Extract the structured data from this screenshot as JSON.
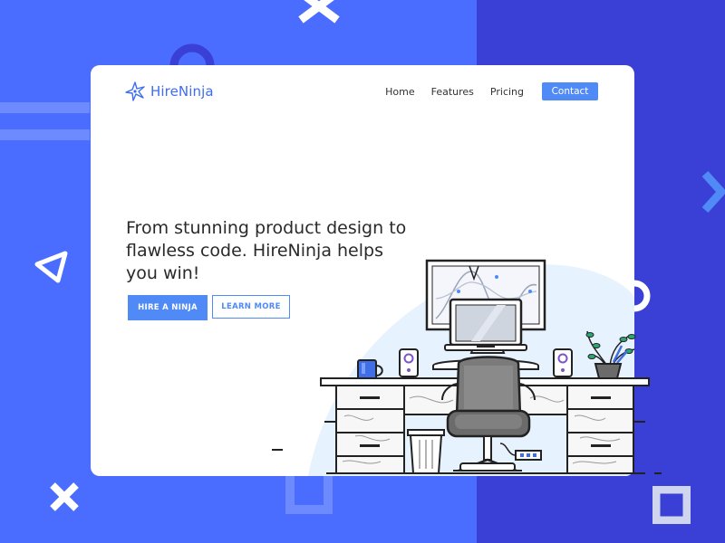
{
  "brand": {
    "name": "HireNinja",
    "logo_icon": "shuriken-icon",
    "accent": "#4f8af7",
    "logo_color": "#3d6cf2"
  },
  "nav": {
    "items": [
      {
        "label": "Home"
      },
      {
        "label": "Features"
      },
      {
        "label": "Pricing"
      }
    ],
    "contact_label": "Contact"
  },
  "hero": {
    "headline": "From stunning product design to flawless code. HireNinja helps you win!",
    "primary_cta": "HIRE A NINJA",
    "secondary_cta": "LEARN MORE"
  },
  "colors": {
    "background": "#4a6cff",
    "background_right": "#3a3fd6",
    "card": "#ffffff"
  }
}
